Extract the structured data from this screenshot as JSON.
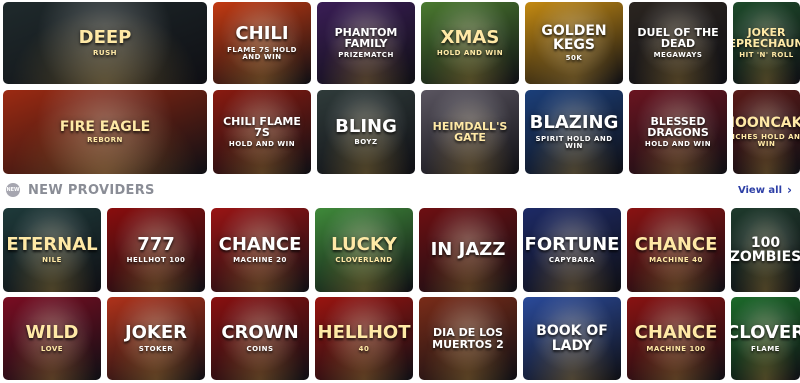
{
  "section": {
    "badge": "NEW",
    "title": "NEW PROVIDERS",
    "view_all": "View all"
  },
  "icons": {
    "view_all": "chevron-right-icon",
    "badge": "new-badge-icon"
  },
  "row1": [
    {
      "title": "DEEP",
      "sub": "RUSH",
      "bg": "#1f2a2c"
    },
    {
      "title": "Chili",
      "sub": "FLAME 7s HOLD AND WIN",
      "bg": "#c33a12"
    },
    {
      "title": "Phantom Family",
      "sub": "PRIZEMATCH",
      "bg": "#3a1d56"
    },
    {
      "title": "Xmas",
      "sub": "HOLD AND WIN",
      "bg": "#4b7a2f"
    },
    {
      "title": "Golden Kegs",
      "sub": "50K",
      "bg": "#c48a12"
    },
    {
      "title": "Duel of the Dead",
      "sub": "MEGAWAYS",
      "bg": "#2b2520"
    },
    {
      "title": "Joker Leprechauns",
      "sub": "HIT 'N' ROLL",
      "bg": "#1d4a2a"
    }
  ],
  "row2": [
    {
      "title": "Fire Eagle",
      "sub": "REBORN",
      "bg": "#9c2a12"
    },
    {
      "title": "Chili Flame 7s",
      "sub": "HOLD AND WIN",
      "bg": "#8a1a10"
    },
    {
      "title": "Bling",
      "sub": "BOYZ",
      "bg": "#2f3b3a"
    },
    {
      "title": "Heimdall's Gate",
      "sub": "",
      "bg": "#5a5560"
    },
    {
      "title": "Blazing",
      "sub": "SPIRIT HOLD AND WIN",
      "bg": "#1b3f7a"
    },
    {
      "title": "Blessed Dragons",
      "sub": "HOLD AND WIN",
      "bg": "#6a1420"
    },
    {
      "title": "Mooncake",
      "sub": "RICHES HOLD AND WIN",
      "bg": "#5a1a18"
    }
  ],
  "row3": [
    {
      "title": "Eternal",
      "sub": "NILE",
      "bg": "#1e3a3a"
    },
    {
      "title": "777",
      "sub": "HELLHOT 100",
      "bg": "#8a0d0d"
    },
    {
      "title": "Chance",
      "sub": "machine 20",
      "bg": "#9a1414"
    },
    {
      "title": "Lucky",
      "sub": "CLOVERLAND",
      "bg": "#3f8a3a"
    },
    {
      "title": "In Jazz",
      "sub": "",
      "bg": "#6e0f12"
    },
    {
      "title": "Fortune",
      "sub": "CAPYBARA",
      "bg": "#1d2a66"
    },
    {
      "title": "Chance",
      "sub": "machine 40",
      "bg": "#8a1212"
    },
    {
      "title": "100 Zombies",
      "sub": "",
      "bg": "#1e3a2c"
    }
  ],
  "row4": [
    {
      "title": "Wild",
      "sub": "LOVE",
      "bg": "#7a0d22"
    },
    {
      "title": "Joker",
      "sub": "STOKER",
      "bg": "#b0321a"
    },
    {
      "title": "Crown",
      "sub": "COINS",
      "bg": "#8a1010"
    },
    {
      "title": "Hellhot",
      "sub": "40",
      "bg": "#9a1410"
    },
    {
      "title": "Dia de los Muertos 2",
      "sub": "",
      "bg": "#7a2c18"
    },
    {
      "title": "Book of Lady",
      "sub": "",
      "bg": "#2a4a9a"
    },
    {
      "title": "Chance",
      "sub": "machine 100",
      "bg": "#8a1212"
    },
    {
      "title": "Clover",
      "sub": "FLAME",
      "bg": "#1c6a2a"
    }
  ],
  "colors": {
    "accent": "#2d3fa6",
    "section_title": "#8a8d96",
    "badge": "#a6a6b0",
    "page_bg": "#ffffff"
  }
}
